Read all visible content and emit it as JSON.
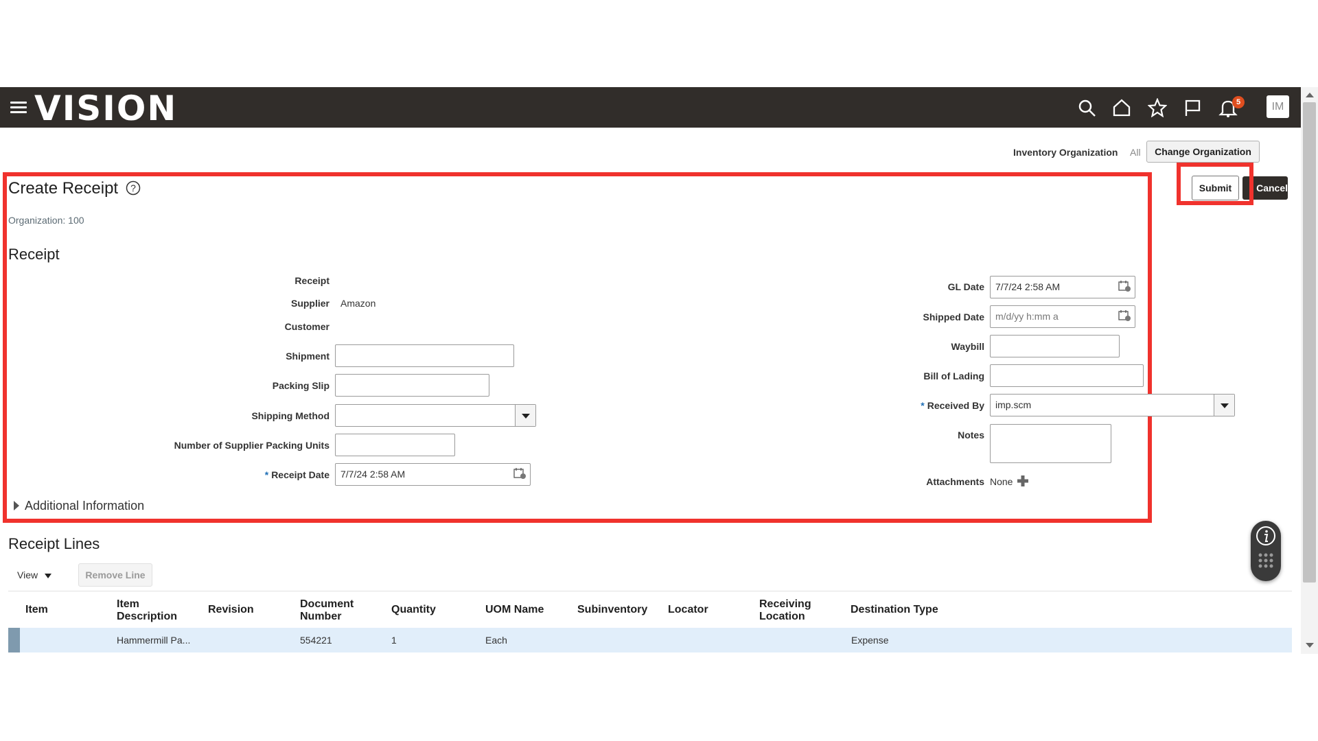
{
  "app": {
    "logo": "VISION",
    "notification_count": "5",
    "avatar_initials": "IM",
    "accent_color": "#312d2a",
    "highlight_color": "#f0322d"
  },
  "header_icons": [
    "search-icon",
    "home-icon",
    "star-icon",
    "flag-icon",
    "bell-icon"
  ],
  "org_bar": {
    "label": "Inventory Organization",
    "value": "All",
    "change_button": "Change Organization"
  },
  "page": {
    "title": "Create Receipt",
    "organization": "Organization: 100",
    "submit_label": "Submit",
    "cancel_label": "Cancel"
  },
  "receipt": {
    "section_title": "Receipt",
    "left": {
      "receipt_label": "Receipt",
      "supplier_label": "Supplier",
      "supplier_value": "Amazon",
      "customer_label": "Customer",
      "shipment_label": "Shipment",
      "shipment_value": "",
      "packing_slip_label": "Packing Slip",
      "packing_slip_value": "",
      "shipping_method_label": "Shipping Method",
      "shipping_method_value": "",
      "packing_units_label": "Number of Supplier Packing Units",
      "packing_units_value": "",
      "receipt_date_label": "Receipt Date",
      "receipt_date_value": "7/7/24 2:58 AM"
    },
    "right": {
      "gl_date_label": "GL Date",
      "gl_date_value": "7/7/24 2:58 AM",
      "shipped_date_label": "Shipped Date",
      "shipped_date_placeholder": "m/d/yy h:mm a",
      "waybill_label": "Waybill",
      "waybill_value": "",
      "bill_of_lading_label": "Bill of Lading",
      "bill_of_lading_value": "",
      "received_by_label": "Received By",
      "received_by_value": "imp.scm",
      "notes_label": "Notes",
      "notes_value": "",
      "attachments_label": "Attachments",
      "attachments_value": "None"
    },
    "additional_info": "Additional Information"
  },
  "receipt_lines": {
    "section_title": "Receipt Lines",
    "view_label": "View",
    "remove_line_label": "Remove Line",
    "columns": [
      "Item",
      "Item Description",
      "Revision",
      "Document Number",
      "Quantity",
      "UOM Name",
      "Subinventory",
      "Locator",
      "Receiving Location",
      "Destination Type"
    ],
    "rows": [
      {
        "item": "",
        "item_description": "Hammermill Pa...",
        "revision": "",
        "document_number": "554221",
        "quantity": "1",
        "uom_name": "Each",
        "subinventory": "",
        "locator": "",
        "receiving_location": "",
        "destination_type": "Expense"
      }
    ]
  }
}
